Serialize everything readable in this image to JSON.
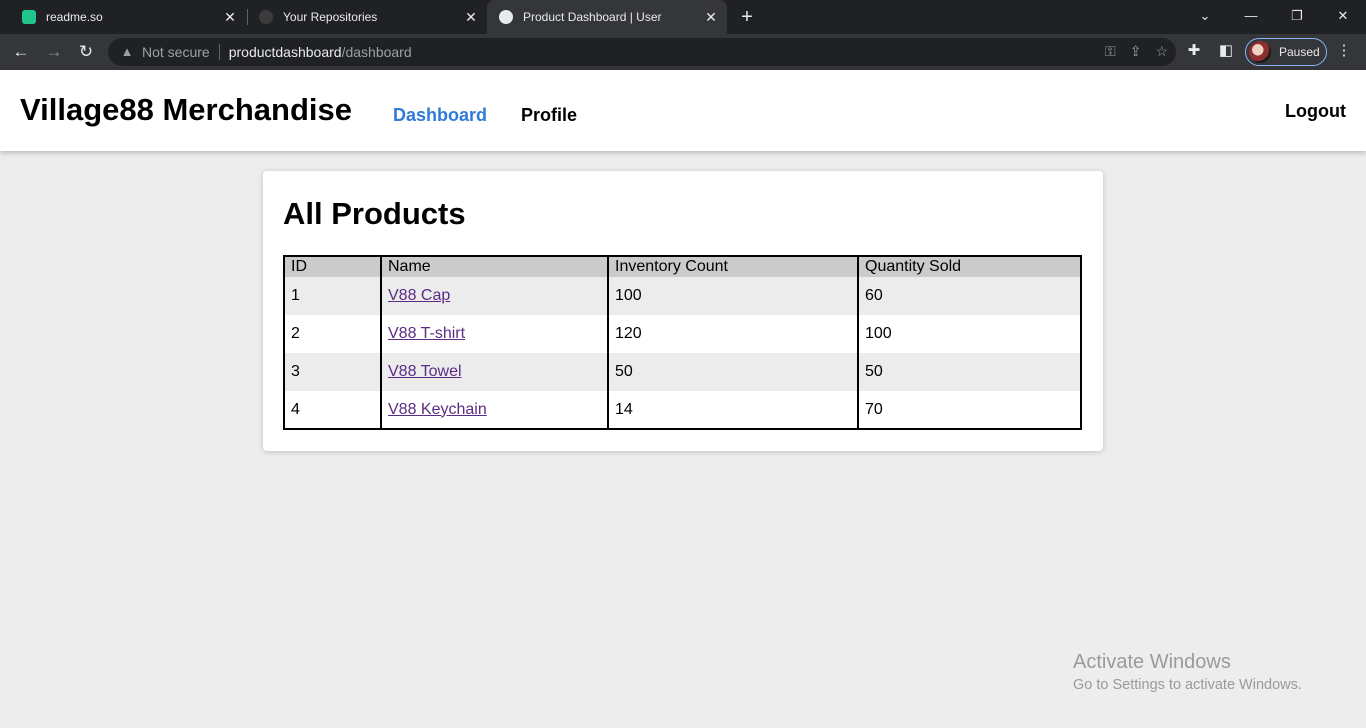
{
  "browser": {
    "tabs": [
      {
        "title": "readme.so",
        "active": false
      },
      {
        "title": "Your Repositories",
        "active": false
      },
      {
        "title": "Product Dashboard | User",
        "active": true
      }
    ],
    "address": {
      "security_label": "Not secure",
      "host": "productdashboard",
      "path": "/dashboard"
    },
    "profile_status": "Paused"
  },
  "header": {
    "brand": "Village88 Merchandise",
    "nav": {
      "dashboard": "Dashboard",
      "profile": "Profile"
    },
    "logout": "Logout",
    "active_color": "#2f7bd9"
  },
  "main": {
    "title": "All Products",
    "table": {
      "columns": [
        "ID",
        "Name",
        "Inventory Count",
        "Quantity Sold"
      ],
      "rows": [
        {
          "id": "1",
          "name": "V88 Cap",
          "inventory": "100",
          "sold": "60"
        },
        {
          "id": "2",
          "name": "V88 T-shirt",
          "inventory": "120",
          "sold": "100"
        },
        {
          "id": "3",
          "name": "V88 Towel",
          "inventory": "50",
          "sold": "50"
        },
        {
          "id": "4",
          "name": "V88 Keychain",
          "inventory": "14",
          "sold": "70"
        }
      ]
    }
  },
  "watermark": {
    "line1": "Activate Windows",
    "line2": "Go to Settings to activate Windows."
  }
}
